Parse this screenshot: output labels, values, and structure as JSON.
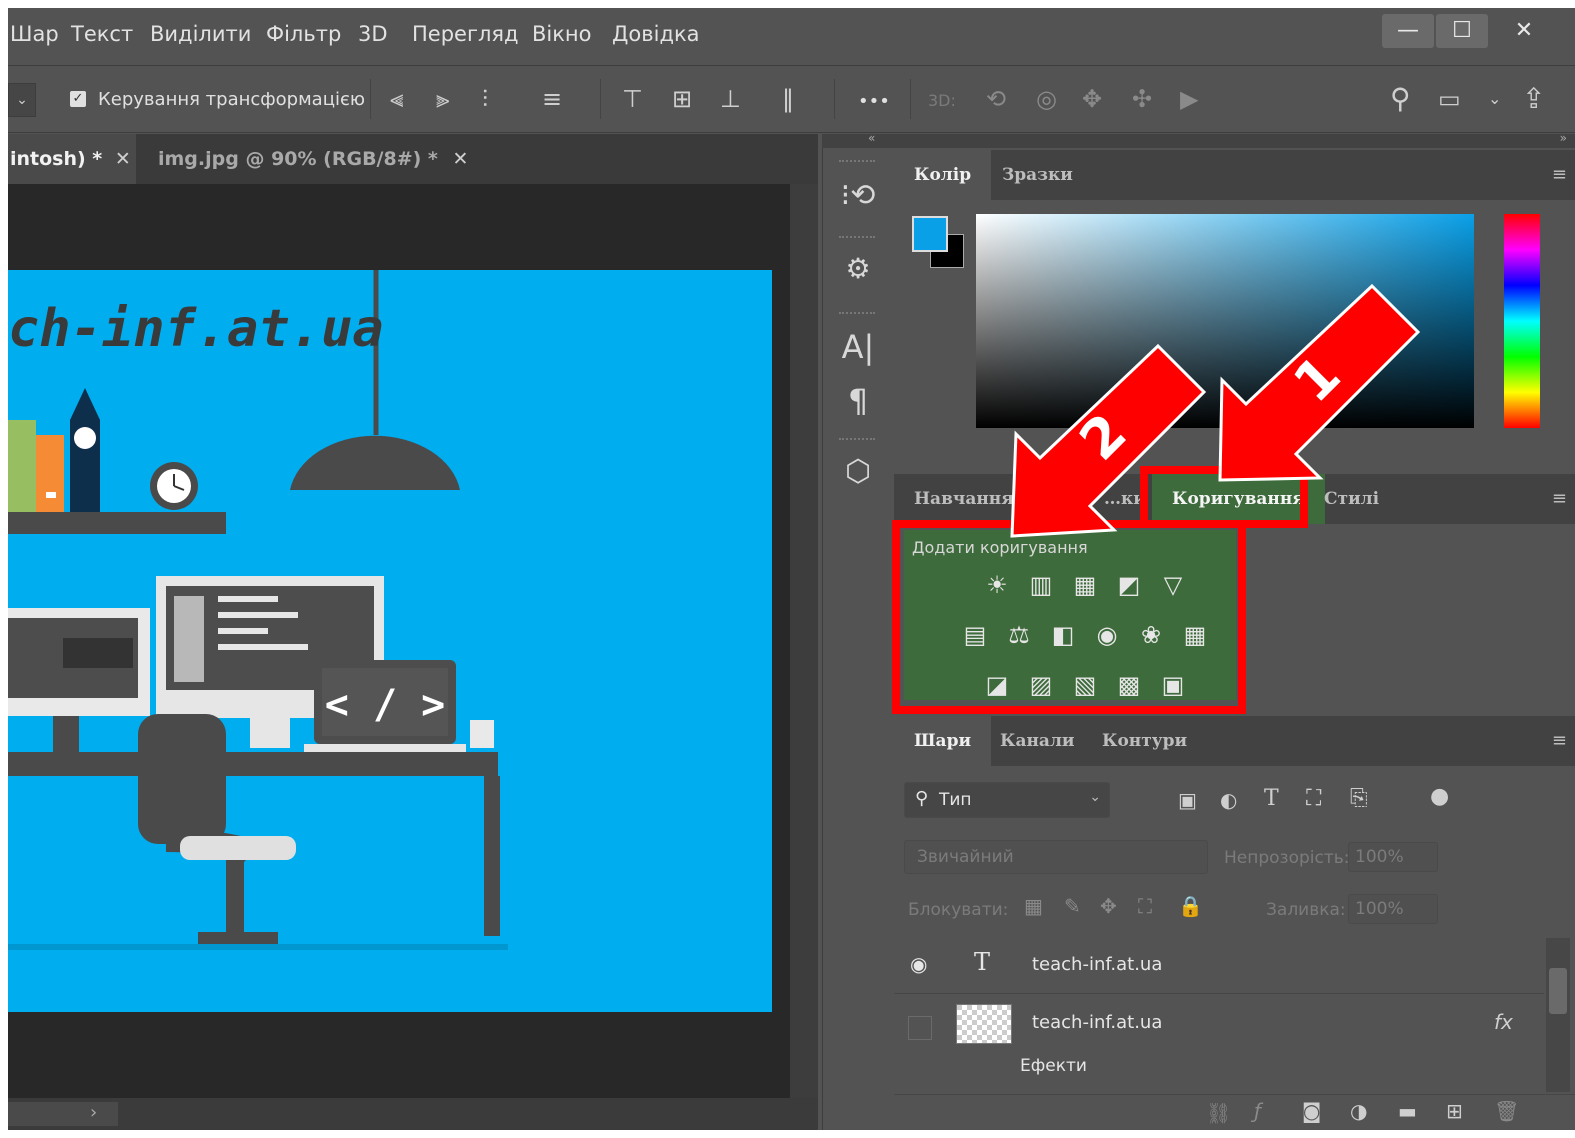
{
  "menu": [
    "Шар",
    "Текст",
    "Виділити",
    "Фільтр",
    "3D",
    "Перегляд",
    "Вікно",
    "Довідка"
  ],
  "window_buttons": {
    "minimize": "—",
    "maximize": "☐",
    "close": "✕"
  },
  "options": {
    "transform_controls_label": "Керування трансформацією",
    "more_label": "•••",
    "threed_label": "3D:"
  },
  "tabs": [
    {
      "label": "intosh) *",
      "close": "✕"
    },
    {
      "label": "img.jpg @ 90% (RGB/8#) *",
      "close": "✕"
    }
  ],
  "canvas": {
    "site_text": "ch-inf.at.ua",
    "code_text": "< / >"
  },
  "color_panel": {
    "tabs": [
      "Колір",
      "Зразки"
    ],
    "foreground": "#0aa0e8",
    "background": "#000000"
  },
  "adjust_panel": {
    "tabs": [
      "Навчання",
      "…ки",
      "Коригування",
      "Стилі"
    ],
    "heading": "Додати коригування",
    "icons_row1": [
      "☀",
      "▥",
      "▦",
      "◩",
      "▽"
    ],
    "icons_row2": [
      "▤",
      "⚖",
      "◧",
      "◉",
      "❀",
      "▦"
    ],
    "icons_row3": [
      "◪",
      "▨",
      "▧",
      "▩",
      "▣"
    ]
  },
  "layers_panel": {
    "tabs": [
      "Шари",
      "Канали",
      "Контури"
    ],
    "filter_label": "Тип",
    "blend_mode": "Звичайний",
    "opacity_label": "Непрозорість:",
    "opacity_value": "100%",
    "lock_label": "Блокувати:",
    "fill_label": "Заливка:",
    "fill_value": "100%",
    "layers": [
      {
        "name": "teach-inf.at.ua",
        "type_glyph": "T"
      },
      {
        "name": "teach-inf.at.ua",
        "fx": "fx",
        "effects_label": "Ефекти"
      }
    ]
  },
  "annotations": {
    "arrow1": "1",
    "arrow2": "2"
  },
  "colors": {
    "highlight_red": "#ff0000",
    "highlight_green": "#3e6b3b",
    "canvas_blue": "#00adef"
  }
}
